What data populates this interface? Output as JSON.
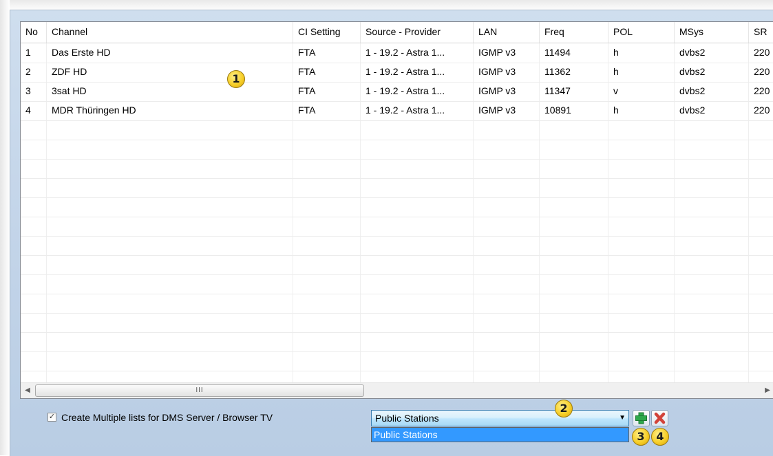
{
  "columns": [
    "No",
    "Channel",
    "CI Setting",
    "Source - Provider",
    "LAN",
    "Freq",
    "POL",
    "MSys",
    "SR"
  ],
  "rows": [
    {
      "no": "1",
      "channel": "Das Erste HD",
      "ci": "FTA",
      "source": "1 - 19.2 - Astra 1...",
      "lan": "IGMP v3",
      "freq": "11494",
      "pol": "h",
      "msys": "dvbs2",
      "sr": "220"
    },
    {
      "no": "2",
      "channel": "ZDF HD",
      "ci": "FTA",
      "source": "1 - 19.2 - Astra 1...",
      "lan": "IGMP v3",
      "freq": "11362",
      "pol": "h",
      "msys": "dvbs2",
      "sr": "220"
    },
    {
      "no": "3",
      "channel": "3sat HD",
      "ci": "FTA",
      "source": "1 - 19.2 - Astra 1...",
      "lan": "IGMP v3",
      "freq": "11347",
      "pol": "v",
      "msys": "dvbs2",
      "sr": "220"
    },
    {
      "no": "4",
      "channel": "MDR Thüringen HD",
      "ci": "FTA",
      "source": "1 - 19.2 - Astra 1...",
      "lan": "IGMP v3",
      "freq": "10891",
      "pol": "h",
      "msys": "dvbs2",
      "sr": "220"
    }
  ],
  "scrollbar": {
    "left_arrow": "◀",
    "right_arrow": "▶",
    "grip": "III"
  },
  "checkbox": {
    "checked": true,
    "mark": "✓",
    "label": "Create Multiple lists for DMS Server / Browser TV"
  },
  "list_select": {
    "value": "Public Stations",
    "options": [
      "Public Stations"
    ],
    "arrow": "▼"
  },
  "buttons": {
    "add_icon": "plus-icon",
    "remove_icon": "remove-icon"
  },
  "badges": [
    "1",
    "2",
    "3",
    "4"
  ],
  "colors": {
    "add_green": "#2ea84a",
    "remove_red": "#d2433a",
    "selection_blue": "#3399ff"
  }
}
